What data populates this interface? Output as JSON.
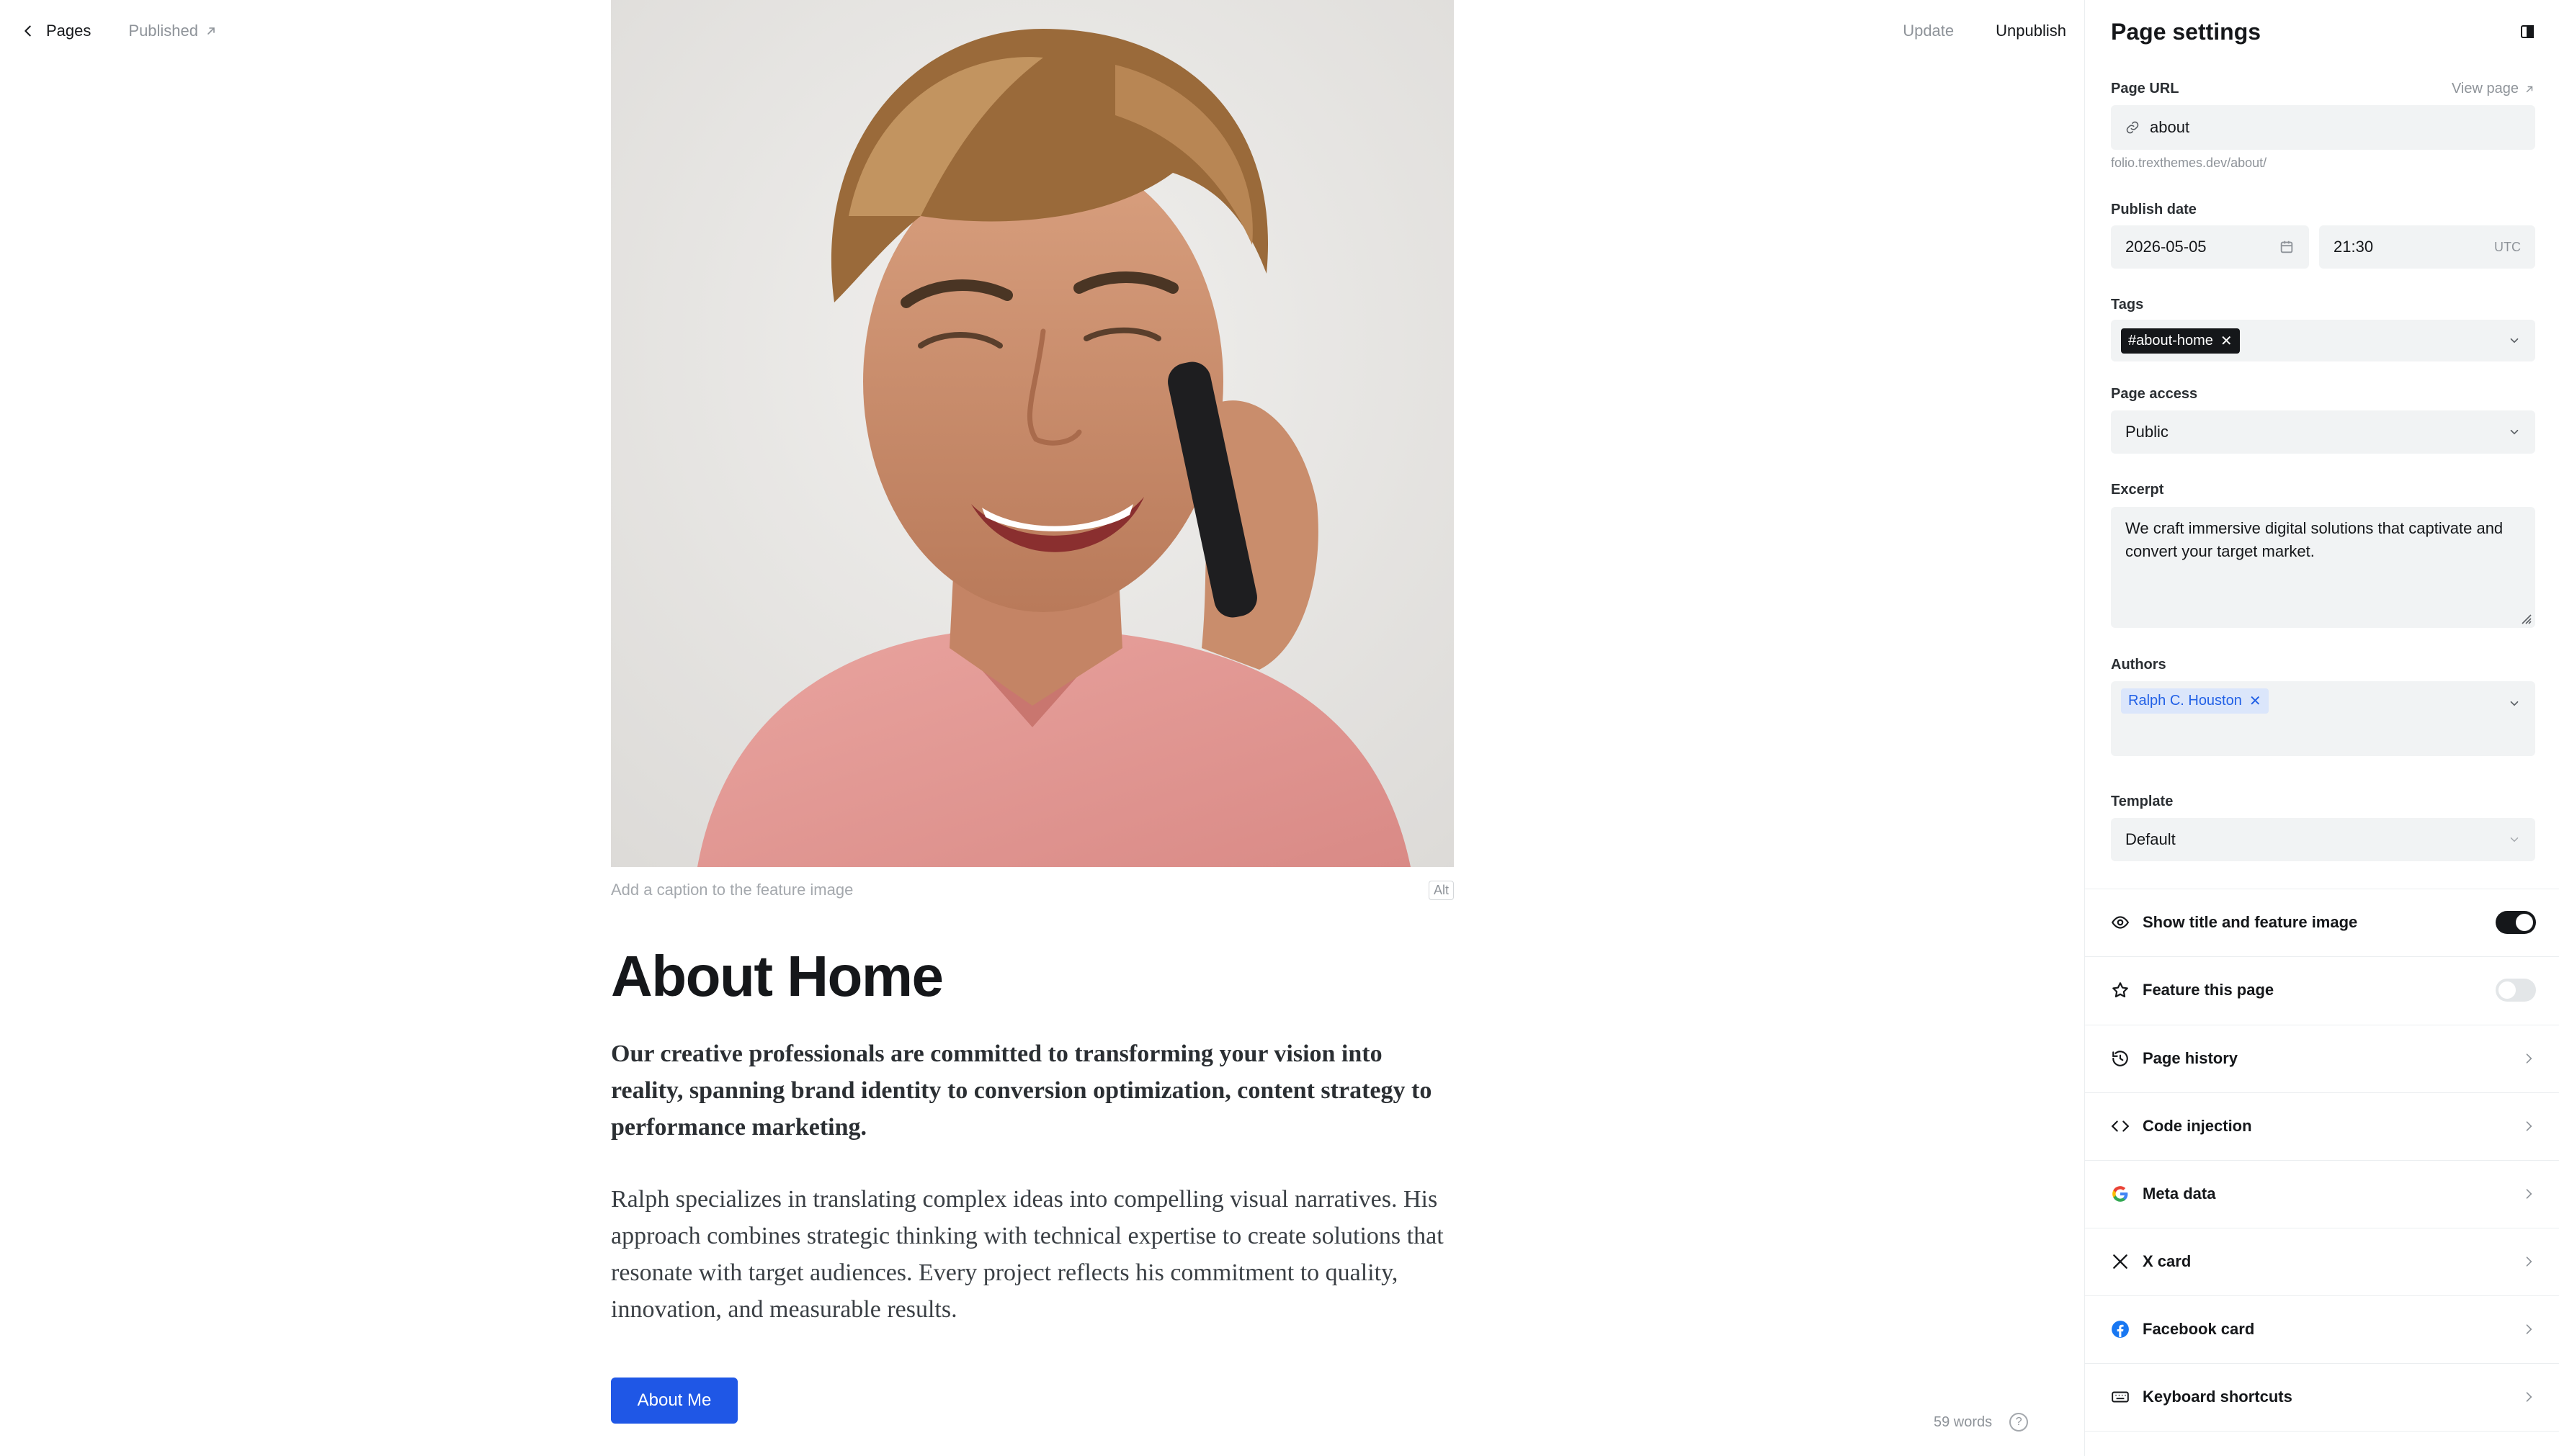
{
  "topbar": {
    "back_label": "Pages",
    "status_label": "Published",
    "update_label": "Update",
    "unpublish_label": "Unpublish"
  },
  "editor": {
    "caption_placeholder": "Add a caption to the feature image",
    "alt_label": "Alt",
    "title": "About Home",
    "lead": "Our creative professionals are committed to transforming your vision into reality, spanning brand identity to conversion optimization, content strategy to performance marketing.",
    "body": "Ralph specializes in translating complex ideas into compelling visual narratives. His approach combines strategic thinking with technical expertise to create solutions that resonate with target audiences. Every project reflects his commitment to quality, innovation, and measurable results.",
    "button_label": "About Me",
    "word_count": "59 words",
    "help_label": "?"
  },
  "sidebar": {
    "title": "Page settings",
    "page_url": {
      "label": "Page URL",
      "view_label": "View page",
      "value": "about",
      "hint": "folio.trexthemes.dev/about/"
    },
    "publish_date": {
      "label": "Publish date",
      "date": "2026-05-05",
      "time": "21:30",
      "timezone": "UTC"
    },
    "tags": {
      "label": "Tags",
      "items": [
        "#about-home"
      ]
    },
    "page_access": {
      "label": "Page access",
      "value": "Public"
    },
    "excerpt": {
      "label": "Excerpt",
      "value": "We craft immersive digital solutions that captivate and convert your target market."
    },
    "authors": {
      "label": "Authors",
      "items": [
        "Ralph C. Houston"
      ]
    },
    "template": {
      "label": "Template",
      "value": "Default"
    },
    "toggles": [
      {
        "label": "Show title and feature image",
        "icon": "eye-icon",
        "on": true
      },
      {
        "label": "Feature this page",
        "icon": "star-icon",
        "on": false
      }
    ],
    "menu": [
      {
        "label": "Page history",
        "icon": "history-icon"
      },
      {
        "label": "Code injection",
        "icon": "code-icon"
      },
      {
        "label": "Meta data",
        "icon": "google-icon"
      },
      {
        "label": "X card",
        "icon": "x-icon"
      },
      {
        "label": "Facebook card",
        "icon": "facebook-icon"
      },
      {
        "label": "Keyboard shortcuts",
        "icon": "keyboard-icon"
      }
    ]
  },
  "colors": {
    "accent": "#1f57e6",
    "toggle_on": "#15171a",
    "author_chip_bg": "#dbe6fb",
    "author_chip_text": "#2160e6"
  }
}
